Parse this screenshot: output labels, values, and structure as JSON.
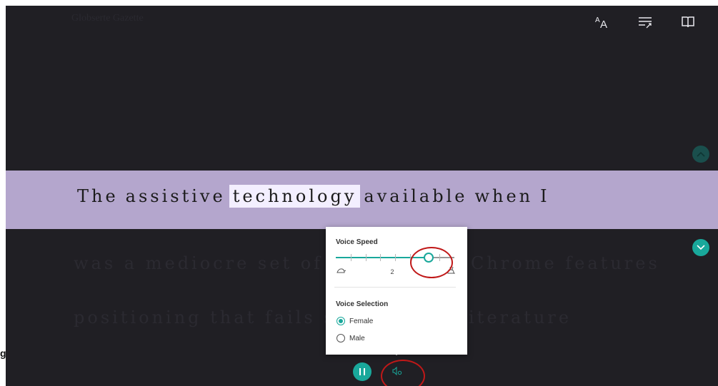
{
  "document": {
    "title": "Globserte Gazette"
  },
  "toolbar": {
    "text_preferences_icon": "text-size-icon",
    "grammar_options_icon": "grammar-options-icon",
    "reading_preferences_icon": "book-icon"
  },
  "reader": {
    "current_line_words": [
      "The",
      "assistive",
      "technology",
      "available",
      "when",
      "I"
    ],
    "highlighted_word": "technology",
    "dim_line_2": "was a mediocre set of Firefox and Chrome features",
    "dim_line_3": "positioning that fails students of literature"
  },
  "voice_panel": {
    "speed_title": "Voice Speed",
    "speed_value": "2",
    "speed_fraction": 0.78,
    "speed_tick_count": 7,
    "selection_title": "Voice Selection",
    "options": [
      {
        "label": "Female",
        "selected": true
      },
      {
        "label": "Male",
        "selected": false
      }
    ]
  },
  "controls": {
    "play_pause_icon": "pause-icon",
    "voice_settings_icon": "voice-settings-icon"
  },
  "edge_glyph": "g",
  "colors": {
    "accent": "#19a89b",
    "background": "#201f24",
    "highlight_band": "#b4a6cd",
    "word_highlight": "#f3efff",
    "annotation": "#c01818"
  }
}
